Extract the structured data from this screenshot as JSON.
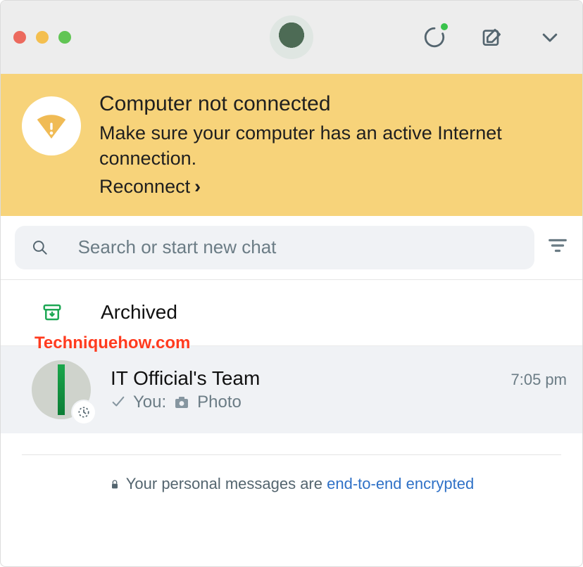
{
  "header": {
    "status_icon": "status-icon",
    "compose_icon": "compose-icon",
    "menu_icon": "chevron-down-icon"
  },
  "banner": {
    "title": "Computer not connected",
    "body": "Make sure your computer has an active Internet connection.",
    "action": "Reconnect"
  },
  "search": {
    "placeholder": "Search or start new chat"
  },
  "archived": {
    "label": "Archived"
  },
  "chat": {
    "name": "IT Official's Team",
    "time": "7:05 pm",
    "preview_prefix": "You:",
    "preview_type": "Photo"
  },
  "encryption": {
    "text": "Your personal messages are ",
    "link": "end-to-end encrypted"
  },
  "watermark": "Techniquehow.com"
}
